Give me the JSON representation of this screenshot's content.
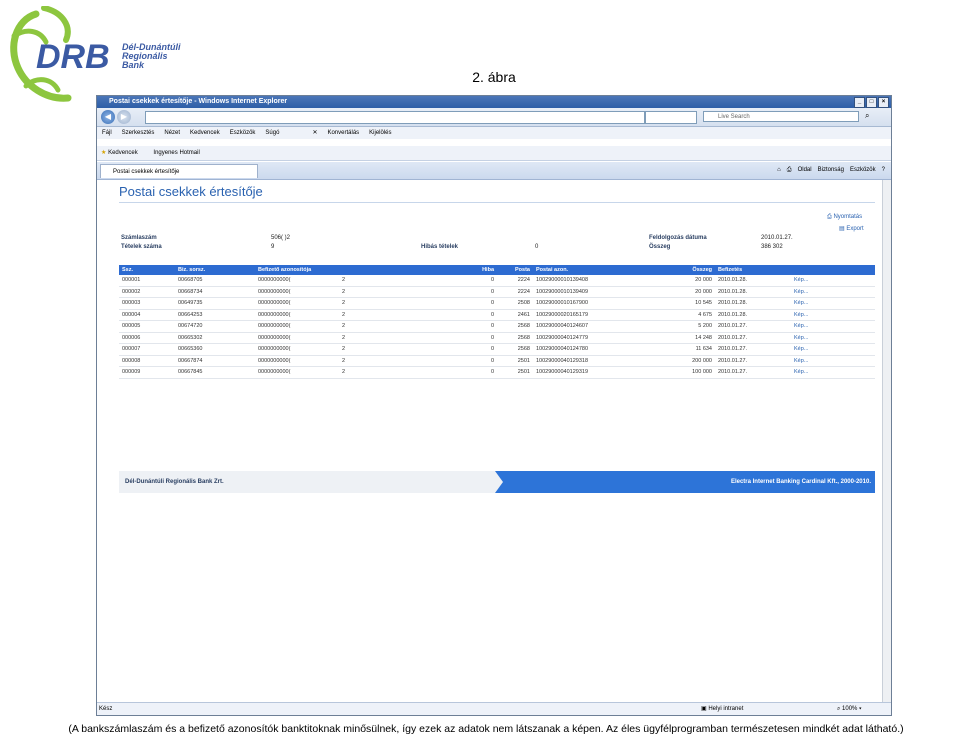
{
  "logo": {
    "abbr": "DRB",
    "line1": "Dél-Dunántúli",
    "line2": "Regionális",
    "line3": "Bank",
    "color": "#3b5aa3",
    "accent": "#8dc63f"
  },
  "figure_label": "2. ábra",
  "browser": {
    "title": "Postai csekkek értesítője - Windows Internet Explorer",
    "search_placeholder": "Live Search",
    "menu": [
      "Fájl",
      "Szerkesztés",
      "Nézet",
      "Kedvencek",
      "Eszközök",
      "Súgó"
    ],
    "toolbar_extras": [
      "Konvertálás",
      "Kijelölés"
    ],
    "favorites": {
      "label": "Kedvencek",
      "hotmail": "Ingyenes Hotmail"
    },
    "tab_title": "Postai csekkek értesítője",
    "commands": [
      "Oldal",
      "Biztonság",
      "Eszközök"
    ],
    "status": {
      "left": "Kész",
      "zone": "Helyi intranet",
      "zoom": "100%"
    }
  },
  "page": {
    "title": "Postai csekkek értesítője",
    "actions": {
      "print": "Nyomtatás",
      "export": "Export"
    },
    "info": {
      "account_label": "Számlaszám",
      "account_value": "506(        )2",
      "items_label": "Tételek száma",
      "items_value": "9",
      "errors_label": "Hibás tételek",
      "errors_value": "0",
      "proc_date_label": "Feldolgozás dátuma",
      "proc_date_value": "2010.01.27.",
      "sum_label": "Összeg",
      "sum_value": "386 302"
    },
    "table": {
      "headers": [
        "Ssz.",
        "Biz. sorsz.",
        "Befizető azonosítója",
        "",
        "Hiba",
        "Posta",
        "Postai azon.",
        "Összeg",
        "Befizetés",
        ""
      ],
      "rows": [
        [
          "000001",
          "00668705",
          "0000000000(",
          "2",
          "0",
          "2224",
          "10029000010139408",
          "20 000",
          "2010.01.28.",
          "Kép..."
        ],
        [
          "000002",
          "00668734",
          "0000000000(",
          "2",
          "0",
          "2224",
          "10029000010139409",
          "20 000",
          "2010.01.28.",
          "Kép..."
        ],
        [
          "000003",
          "00649735",
          "0000000000(",
          "2",
          "0",
          "2508",
          "10029000010167900",
          "10 545",
          "2010.01.28.",
          "Kép..."
        ],
        [
          "000004",
          "00664253",
          "0000000000(",
          "2",
          "0",
          "2461",
          "10029000020165179",
          "4 675",
          "2010.01.28.",
          "Kép..."
        ],
        [
          "000005",
          "00674720",
          "0000000000(",
          "2",
          "0",
          "2568",
          "10029000040124607",
          "5 200",
          "2010.01.27.",
          "Kép..."
        ],
        [
          "000006",
          "00665302",
          "0000000000(",
          "2",
          "0",
          "2568",
          "10029000040124779",
          "14 248",
          "2010.01.27.",
          "Kép..."
        ],
        [
          "000007",
          "00665360",
          "0000000000(",
          "2",
          "0",
          "2568",
          "10029000040124780",
          "11 634",
          "2010.01.27.",
          "Kép..."
        ],
        [
          "000008",
          "00667874",
          "0000000000(",
          "2",
          "0",
          "2501",
          "10029000040129318",
          "200 000",
          "2010.01.27.",
          "Kép..."
        ],
        [
          "000009",
          "00667845",
          "0000000000(",
          "2",
          "0",
          "2501",
          "10029000040129319",
          "100 000",
          "2010.01.27.",
          "Kép..."
        ]
      ]
    },
    "footer": {
      "left": "Dél-Dunántúli Regionális Bank Zrt.",
      "right": "Electra Internet Banking Cardinal Kft., 2000-2010."
    }
  },
  "caption": "(A bankszámlaszám és a befizető azonosítók banktitoknak minősülnek, így ezek az adatok nem látszanak a képen. Az éles ügyfélprogramban természetesen mindkét adat látható.)"
}
